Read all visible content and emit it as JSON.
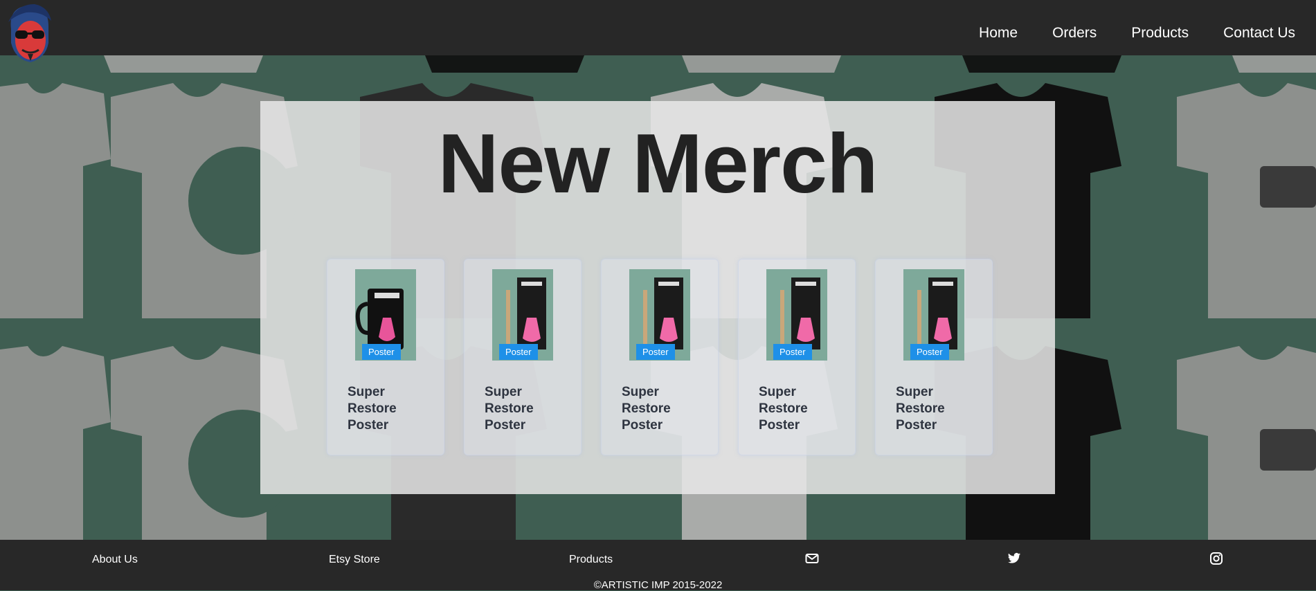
{
  "header": {
    "nav": [
      "Home",
      "Orders",
      "Products",
      "Contact Us"
    ]
  },
  "panel": {
    "title": "New Merch"
  },
  "products": [
    {
      "tag": "Poster",
      "title": "Super Restore Poster",
      "image": "mug"
    },
    {
      "tag": "Poster",
      "title": "Super Restore Poster",
      "image": "poster"
    },
    {
      "tag": "Poster",
      "title": "Super Restore Poster",
      "image": "poster"
    },
    {
      "tag": "Poster",
      "title": "Super Restore Poster",
      "image": "poster"
    },
    {
      "tag": "Poster",
      "title": "Super Restore Poster",
      "image": "poster"
    }
  ],
  "footer": {
    "links": [
      "About Us",
      "Etsy Store",
      "Products"
    ],
    "icons": [
      "envelope-icon",
      "twitter-icon",
      "instagram-icon"
    ],
    "copyright": "©ARTISTIC IMP 2015-2022"
  },
  "colors": {
    "nav_bg": "#282828",
    "accent": "#1e90e8",
    "hero_bg": "#3f5e52"
  }
}
